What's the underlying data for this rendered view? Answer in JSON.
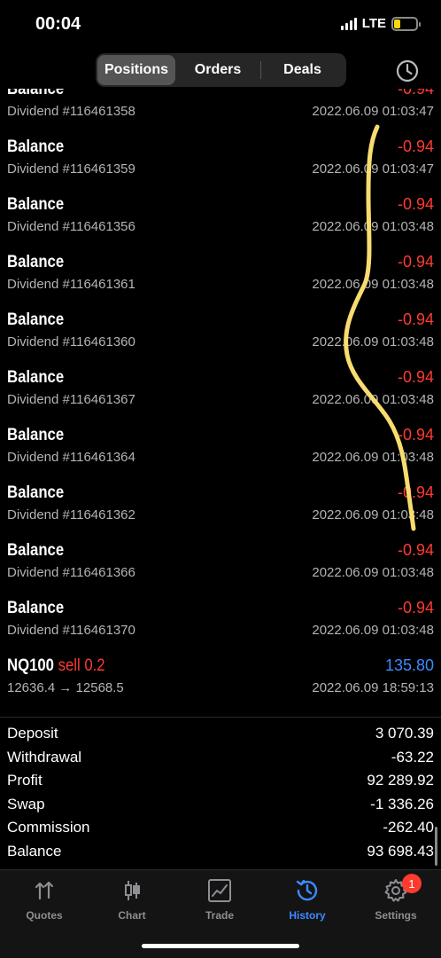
{
  "status": {
    "time": "00:04",
    "network": "LTE"
  },
  "header": {
    "tabs": [
      "Positions",
      "Orders",
      "Deals"
    ],
    "active_tab": 0
  },
  "deals": [
    {
      "title": "Balance",
      "sub": "Dividend #116461358",
      "value": "-0.94",
      "time": "2022.06.09 01:03:47"
    },
    {
      "title": "Balance",
      "sub": "Dividend #116461359",
      "value": "-0.94",
      "time": "2022.06.09 01:03:47"
    },
    {
      "title": "Balance",
      "sub": "Dividend #116461356",
      "value": "-0.94",
      "time": "2022.06.09 01:03:48"
    },
    {
      "title": "Balance",
      "sub": "Dividend #116461361",
      "value": "-0.94",
      "time": "2022.06.09 01:03:48"
    },
    {
      "title": "Balance",
      "sub": "Dividend #116461360",
      "value": "-0.94",
      "time": "2022.06.09 01:03:48"
    },
    {
      "title": "Balance",
      "sub": "Dividend #116461367",
      "value": "-0.94",
      "time": "2022.06.09 01:03:48"
    },
    {
      "title": "Balance",
      "sub": "Dividend #116461364",
      "value": "-0.94",
      "time": "2022.06.09 01:03:48"
    },
    {
      "title": "Balance",
      "sub": "Dividend #116461362",
      "value": "-0.94",
      "time": "2022.06.09 01:03:48"
    },
    {
      "title": "Balance",
      "sub": "Dividend #116461366",
      "value": "-0.94",
      "time": "2022.06.09 01:03:48"
    },
    {
      "title": "Balance",
      "sub": "Dividend #116461370",
      "value": "-0.94",
      "time": "2022.06.09 01:03:48"
    }
  ],
  "trade": {
    "symbol": "NQ100",
    "side": "sell 0.2",
    "prices": "12636.4 → 12568.5",
    "value": "135.80",
    "time": "2022.06.09 18:59:13"
  },
  "summary": [
    {
      "label": "Deposit",
      "value": "3 070.39"
    },
    {
      "label": "Withdrawal",
      "value": "-63.22"
    },
    {
      "label": "Profit",
      "value": "92 289.92"
    },
    {
      "label": "Swap",
      "value": "-1 336.26"
    },
    {
      "label": "Commission",
      "value": "-262.40"
    },
    {
      "label": "Balance",
      "value": "93 698.43"
    }
  ],
  "tabbar": {
    "tabs": [
      {
        "label": "Quotes",
        "icon": "quotes-arrows-icon"
      },
      {
        "label": "Chart",
        "icon": "candlestick-icon"
      },
      {
        "label": "Trade",
        "icon": "trade-chart-icon"
      },
      {
        "label": "History",
        "icon": "history-clock-icon"
      },
      {
        "label": "Settings",
        "icon": "gear-icon"
      }
    ],
    "active": "History",
    "settings_badge": "1"
  },
  "colors": {
    "negative": "#ff3b30",
    "positive": "#3b8bff",
    "accent": "#3b8bff",
    "highlight_scribble": "#f7dc6f"
  }
}
